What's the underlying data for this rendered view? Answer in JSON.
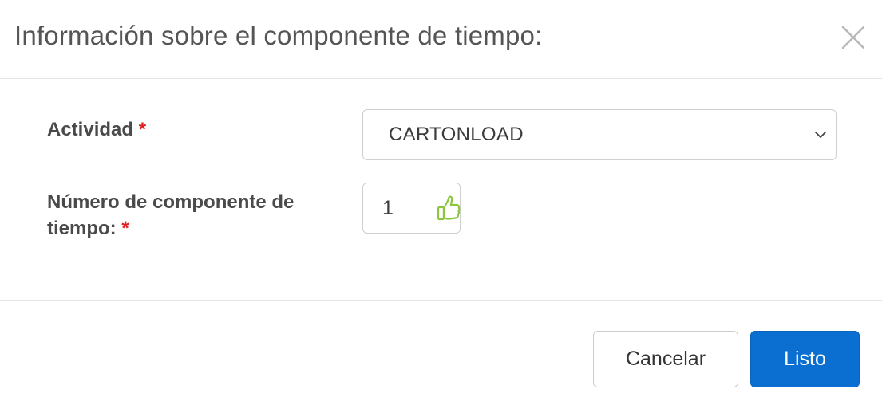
{
  "dialog": {
    "title": "Información sobre el componente de tiempo:",
    "close_icon": "close-icon"
  },
  "form": {
    "activity": {
      "label": "Actividad",
      "required_mark": "*",
      "selected_value": "CARTONLOAD",
      "chevron_icon": "chevron-down-icon"
    },
    "component_number": {
      "label": "Número de componente de tiempo:",
      "required_mark": "*",
      "value": "1",
      "status_icon": "thumbs-up-icon",
      "status_icon_color": "#8cc63f"
    }
  },
  "footer": {
    "cancel_label": "Cancelar",
    "done_label": "Listo"
  },
  "colors": {
    "primary": "#0a6fd1",
    "required": "#e02020"
  }
}
